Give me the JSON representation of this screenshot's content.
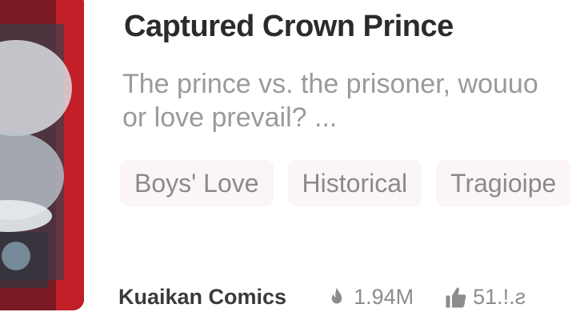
{
  "comic": {
    "title": "Captured Crown Prince",
    "description_line1": "The prince vs. the prisoner, wouuo",
    "description_line2": "or love prevail? ...",
    "tags": [
      "Boys' Love",
      "Historical",
      "Tragioipe"
    ],
    "publisher": "Kuaikan Comics",
    "views": "1.94M",
    "likes": "51.!.ƨ"
  },
  "icons": {
    "views_icon": "flame-icon",
    "likes_icon": "thumbs-up-icon"
  },
  "colors": {
    "cover_accent": "#a01c24",
    "title": "#2b2b2b",
    "muted": "#9a9a9a",
    "tag_bg": "#fbf5f7"
  }
}
